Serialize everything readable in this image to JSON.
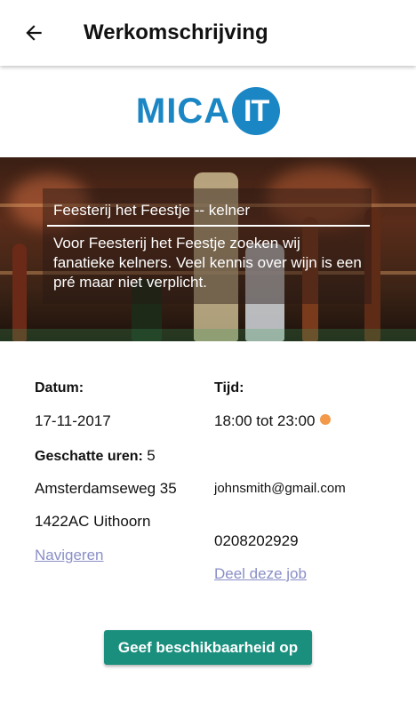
{
  "appbar": {
    "title": "Werkomschrijving",
    "back_icon": "arrow-left-icon"
  },
  "logo": {
    "text": "MICA",
    "badge": "IT",
    "color": "#1b86c4"
  },
  "job": {
    "title": "Feesterij het Feestje -- kelner",
    "description": "Voor Feesterij het Feestje zoeken wij fanatieke kelners. Veel kennis over wijn is een pré maar niet verplicht."
  },
  "details": {
    "date_label": "Datum:",
    "date_value": "17-11-2017",
    "time_label": "Tijd:",
    "time_value": "18:00 tot 23:00",
    "status_color": "#f2994a",
    "hours_label": "Geschatte uren:",
    "hours_value": "5",
    "street": "Amsterdamseweg 35",
    "postal_city": "1422AC Uithoorn",
    "email": "johnsmith@gmail.com",
    "phone": "0208202929",
    "navigate_link": "Navigeren",
    "share_link": "Deel deze job"
  },
  "cta": {
    "label": "Geef beschikbaarheid op",
    "color": "#1a8f7d"
  }
}
